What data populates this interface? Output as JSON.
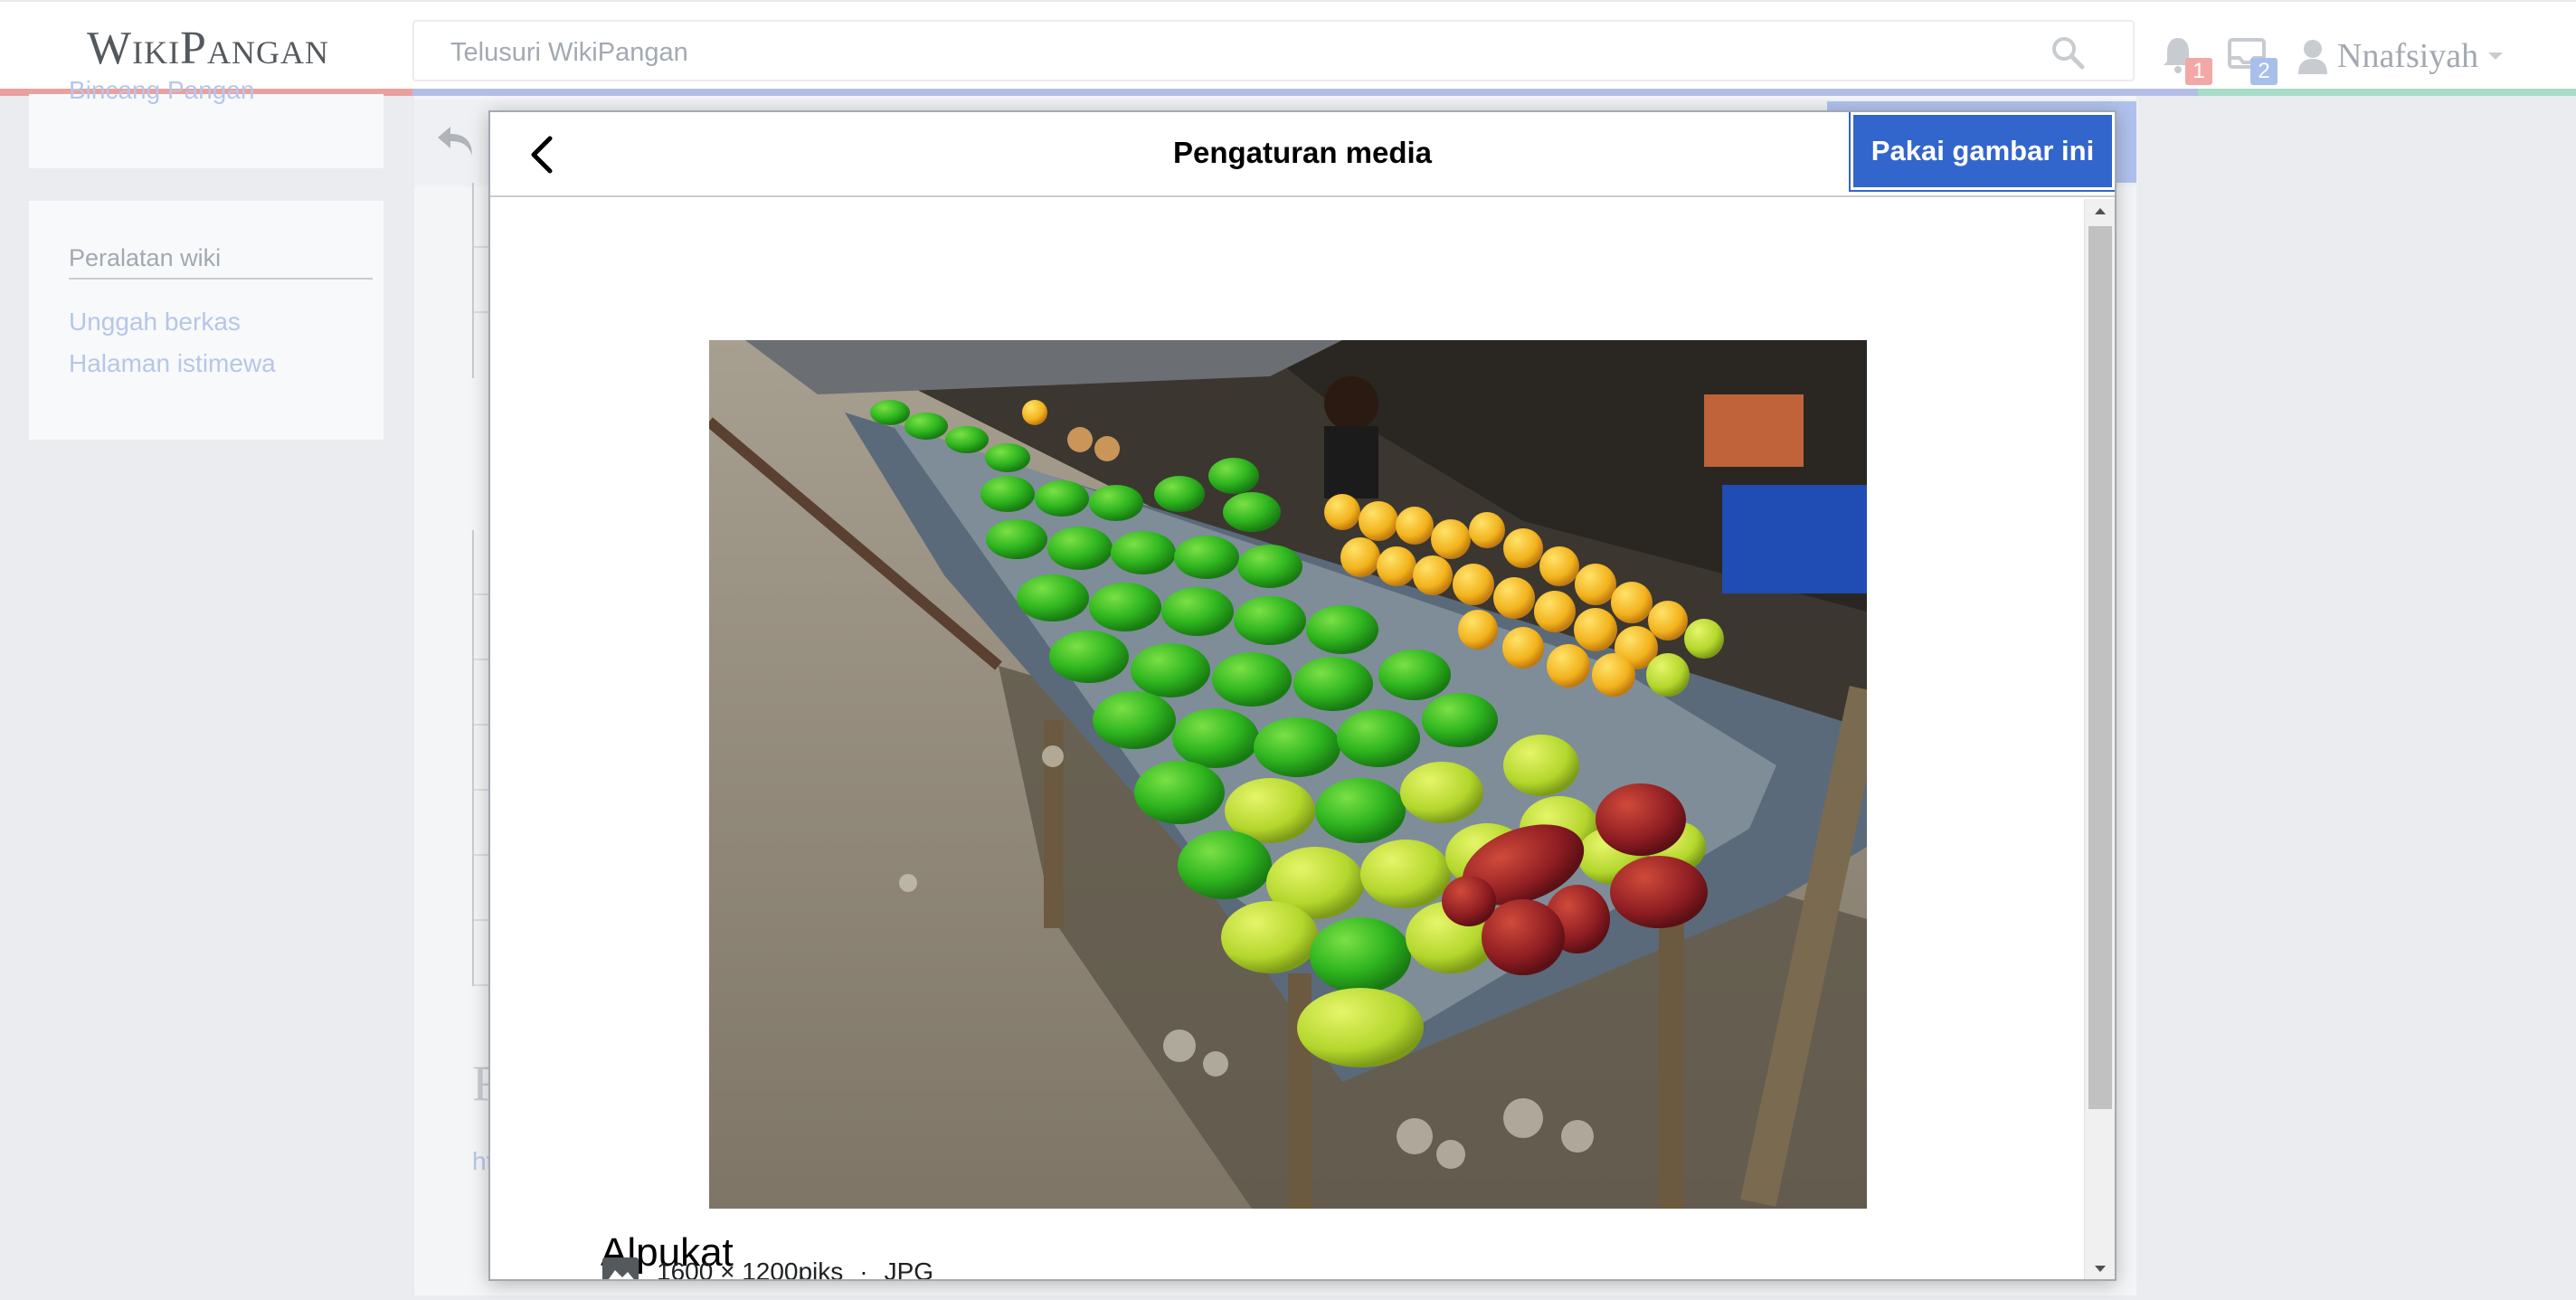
{
  "header": {
    "logo": "WikiPangan",
    "search_placeholder": "Telusuri WikiPangan",
    "notifications_count": "1",
    "messages_count": "2",
    "username": "Nnafsiyah"
  },
  "sidebar": {
    "cut_link": "Bincang Pangan",
    "tools_title": "Peralatan wiki",
    "tools_links": [
      "Unggah berkas",
      "Halaman istimewa"
    ]
  },
  "article": {
    "heading_fragment": "R",
    "link_fragment": "ht"
  },
  "dialog": {
    "title": "Pengaturan media",
    "use_button": "Pakai gambar ini",
    "file_title": "Alpukat",
    "file_dimensions": "1600 × 1200piks",
    "separator": "·",
    "file_type": "JPG"
  },
  "colors": {
    "accent": "#3366cc",
    "text": "#202122",
    "muted": "#a2a9b1"
  },
  "icons": {
    "search": "search-icon",
    "bell": "bell-icon",
    "tray": "tray-icon",
    "user": "user-icon",
    "undo": "undo-icon",
    "back": "chevron-left-icon",
    "image": "image-icon"
  }
}
